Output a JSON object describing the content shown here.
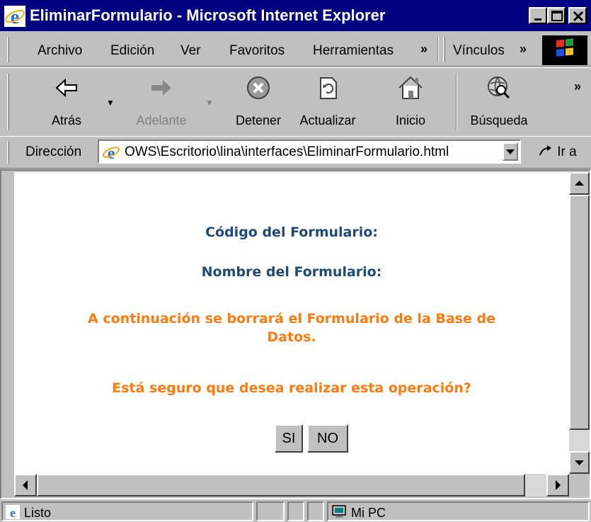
{
  "window": {
    "title": "EliminarFormulario - Microsoft Internet Explorer"
  },
  "menu": {
    "items": [
      "Archivo",
      "Edición",
      "Ver",
      "Favoritos",
      "Herramientas"
    ],
    "more": "»",
    "links_label": "Vínculos",
    "links_more": "»"
  },
  "toolbar": {
    "back": "Atrás",
    "forward": "Adelante",
    "stop": "Detener",
    "refresh": "Actualizar",
    "home": "Inicio",
    "search": "Búsqueda",
    "more": "»"
  },
  "address": {
    "label": "Dirección",
    "value": "OWS\\Escritorio\\lina\\interfaces\\EliminarFormulario.html",
    "go": "Ir a"
  },
  "content": {
    "codigo_label": "Código del Formulario:",
    "nombre_label": "Nombre del Formulario:",
    "warning_line1": "A continuación se borrará el Formulario de la Base de",
    "warning_line2": "Datos.",
    "question": "Está seguro que desea realizar esta operación?",
    "yes_button": "SI",
    "no_button": "NO"
  },
  "status": {
    "text": "Listo",
    "zone": "Mi PC"
  },
  "colors": {
    "titlebar": "#000080",
    "heading": "#1f4a78",
    "warning": "#ff7a10"
  }
}
